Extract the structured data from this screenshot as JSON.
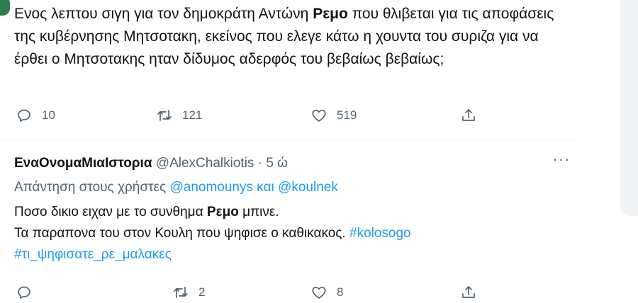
{
  "tweet1": {
    "text_before": "Ενος λεπτου σιγη για τον δημοκράτη Αντώνη ",
    "highlight": "Ρεμο",
    "text_after": " που  θλιβεται για τις αποφάσεις της κυβέρνησης Μητσοτακη, εκείνος που ελεγε κάτω η χουντα του συριζα για να έρθει ο Μητσοτακης ηταν δίδυμος αδερφός του βεβαίως βεβαίως;",
    "replies": "10",
    "retweets": "121",
    "likes": "519"
  },
  "tweet2": {
    "name": "ΕναΟνομαΜιαΙστορια",
    "handle": "@AlexChalkiotis",
    "separator": "·",
    "time": "5 ώ",
    "more": "···",
    "reply_prefix": "Απάντηση στους χρήστες ",
    "reply_user1": "@anomounys",
    "reply_and": " και ",
    "reply_user2": "@koulnek",
    "line1_before": "Ποσο δικιο ειχαν με το συνθημα ",
    "line1_highlight": "Ρεμο",
    "line1_after": " μπινε.",
    "line2_text": "Τα παραπονα του στον Κουλη που ψηφισε ο καθικακος. ",
    "hashtag1": "#kolosogo",
    "hashtag2": "#τι_ψηφισατε_ρε_μαλακες",
    "replies": "",
    "retweets": "2",
    "likes": "8"
  },
  "icons": {
    "reply": "reply-icon",
    "retweet": "retweet-icon",
    "like": "heart-icon",
    "share": "share-icon",
    "more": "more-icon"
  },
  "colors": {
    "text": "#0f1419",
    "secondary": "#536471",
    "link": "#1d9bf0"
  }
}
